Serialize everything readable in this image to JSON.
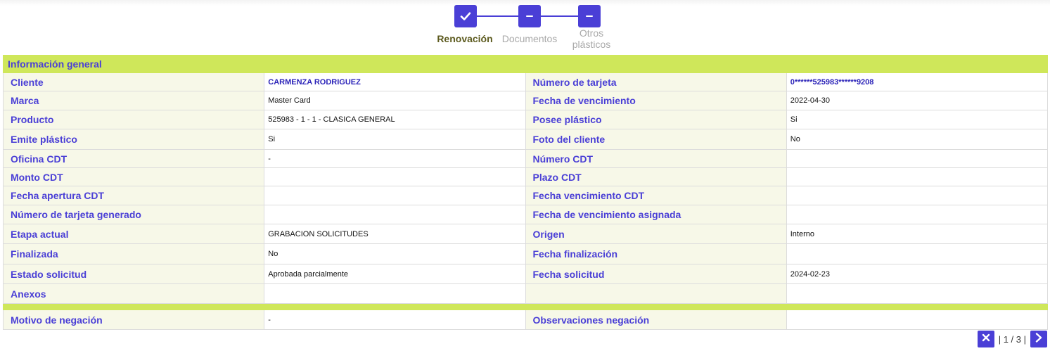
{
  "stepper": {
    "steps": [
      {
        "label": "Renovación",
        "state": "done",
        "icon": "check-icon"
      },
      {
        "label": "Documentos",
        "state": "pending",
        "icon": "minus-icon"
      },
      {
        "label_line1": "Otros",
        "label_line2": "plásticos",
        "state": "pending",
        "icon": "minus-icon"
      }
    ]
  },
  "section_title": "Información general",
  "rows": [
    {
      "l1": "Cliente",
      "v1": "CARMENZA RODRIGUEZ",
      "l2": "Número de tarjeta",
      "v2": "0******525983******9208"
    },
    {
      "l1": "Marca",
      "v1": "Master Card",
      "l2": "Fecha de vencimiento",
      "v2": "2022-04-30"
    },
    {
      "l1": "Producto",
      "v1": "525983 - 1 - 1 - CLASICA GENERAL",
      "l2": "Posee plástico",
      "v2": "Si"
    },
    {
      "l1": "Emite plástico",
      "v1": "Si",
      "l2": "Foto del cliente",
      "v2": "No"
    },
    {
      "l1": "Oficina CDT",
      "v1": "-",
      "l2": "Número CDT",
      "v2": ""
    },
    {
      "l1": "Monto CDT",
      "v1": "",
      "l2": "Plazo CDT",
      "v2": ""
    },
    {
      "l1": "Fecha apertura CDT",
      "v1": "",
      "l2": "Fecha vencimiento CDT",
      "v2": ""
    },
    {
      "l1": "Número de tarjeta generado",
      "v1": "",
      "l2": "Fecha de vencimiento asignada",
      "v2": ""
    },
    {
      "l1": "Etapa actual",
      "v1": "GRABACION SOLICITUDES",
      "l2": "Origen",
      "v2": "Interno"
    },
    {
      "l1": "Finalizada",
      "v1": "No",
      "l2": "Fecha finalización",
      "v2": ""
    },
    {
      "l1": "Estado solicitud",
      "v1": "Aprobada parcialmente",
      "l2": "Fecha solicitud",
      "v2": "2024-02-23"
    },
    {
      "l1": "Anexos",
      "v1": "",
      "l2": "",
      "v2": ""
    }
  ],
  "negation_row": {
    "l1": "Motivo de negación",
    "v1": "-",
    "l2": "Observaciones negación",
    "v2": ""
  },
  "pager": {
    "text": "| 1 / 3 |",
    "close_icon": "close-icon",
    "next_icon": "chevron-right-icon"
  },
  "colors": {
    "accent": "#4a3fd6",
    "header_bg": "#cfe75a",
    "label_bg": "#f7f8e8"
  }
}
